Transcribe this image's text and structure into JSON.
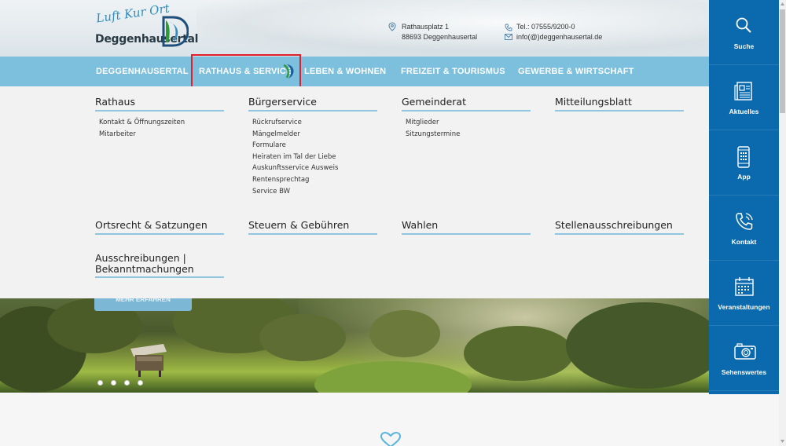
{
  "header": {
    "logo_script": "Luft Kur Ort",
    "logo_name": "Deggenhausertal",
    "address_line1": "Rathausplatz 1",
    "address_line2": "88693 Deggenhausertal",
    "phone": "Tel.: 07555/9200-0",
    "email": "info(@)deggenhausertal.de"
  },
  "nav": {
    "items": [
      {
        "label": "DEGGENHAUSERTAL"
      },
      {
        "label": "RATHAUS & SERVICE"
      },
      {
        "label": "LEBEN & WOHNEN"
      },
      {
        "label": "FREIZEIT & TOURISMUS"
      },
      {
        "label": "GEWERBE & WIRTSCHAFT"
      }
    ],
    "active_index": 1
  },
  "mega": {
    "sections": [
      {
        "title": "Rathaus",
        "links": [
          "Kontakt & Öffnungszeiten",
          "Mitarbeiter"
        ]
      },
      {
        "title": "Bürgerservice",
        "links": [
          "Rückrufservice",
          "Mängelmelder",
          "Formulare",
          "Heiraten im Tal der Liebe",
          "Auskunftsservice Ausweis",
          "Rentensprechtag",
          "Service BW"
        ]
      },
      {
        "title": "Gemeinderat",
        "links": [
          "Mitglieder",
          "Sitzungstermine"
        ]
      },
      {
        "title": "Mitteilungsblatt",
        "links": []
      },
      {
        "title": "Ortsrecht & Satzungen",
        "links": []
      },
      {
        "title": "Steuern & Gebühren",
        "links": []
      },
      {
        "title": "Wahlen",
        "links": []
      },
      {
        "title": "Stellenausschreibungen",
        "links": []
      },
      {
        "title": "Ausschreibungen |",
        "title2": "Bekanntmachungen",
        "links": []
      }
    ]
  },
  "hero": {
    "more_label": "MEHR ERFAHREN",
    "slide_count": 4
  },
  "sidebar": {
    "items": [
      {
        "label": "Suche",
        "icon": "search-icon"
      },
      {
        "label": "Aktuelles",
        "icon": "news-icon"
      },
      {
        "label": "App",
        "icon": "phone-app-icon"
      },
      {
        "label": "Kontakt",
        "icon": "phone-call-icon"
      },
      {
        "label": "Veranstaltungen",
        "icon": "calendar-icon"
      },
      {
        "label": "Sehenswertes",
        "icon": "camera-icon"
      }
    ]
  },
  "colors": {
    "nav_bg": "#7cc0dd",
    "sidebar_bg": "#0a6aad",
    "accent_line": "#8ec6df",
    "active_outline": "#e0202a"
  }
}
